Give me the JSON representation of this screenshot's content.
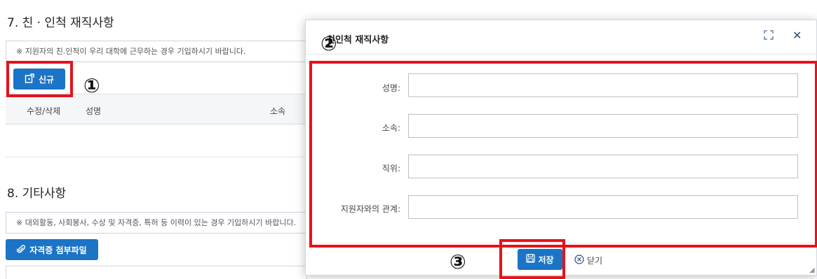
{
  "page": {
    "section7": {
      "title": "7. 친 · 인척 재직사항",
      "notice": "※ 지원자의 친.인척이 우리 대학에 근무하는 경우 기입하시기 바랍니다.",
      "new_button": "신규",
      "columns": [
        "수정/삭제",
        "성명",
        "소속"
      ]
    },
    "section8": {
      "title": "8. 기타사항",
      "notice": "※ 대외활동, 사회봉사, 수상 및 자격증, 특허 등 이력이 있는 경우 기입하시기 바랍니다.",
      "attach_button": "자격증 첨부파일"
    }
  },
  "dialog": {
    "title": "친인척 재직사항",
    "fields": [
      {
        "label": "성명:",
        "value": ""
      },
      {
        "label": "소속:",
        "value": ""
      },
      {
        "label": "직위:",
        "value": ""
      },
      {
        "label": "지원자와의 관계:",
        "value": ""
      }
    ],
    "save_label": "저장",
    "close_label": "닫기"
  },
  "annotations": [
    "①",
    "②",
    "③"
  ],
  "colors": {
    "accent": "#1b74c5",
    "highlight": "#e8111a"
  }
}
